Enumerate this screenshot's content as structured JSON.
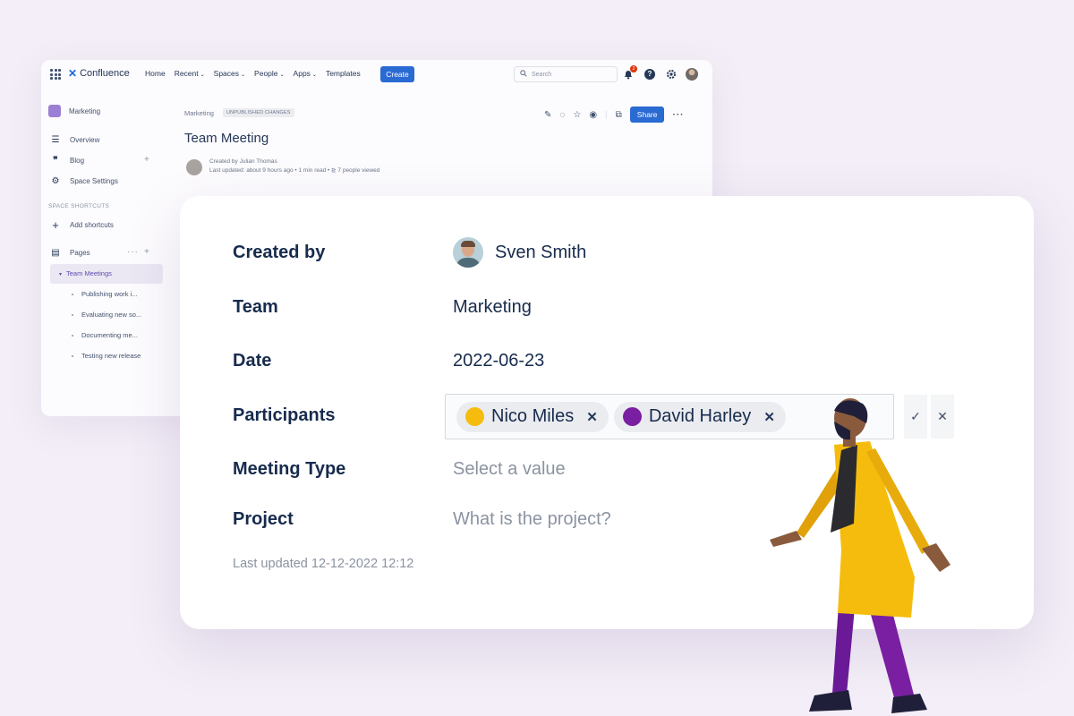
{
  "confluence": {
    "logo_text": "Confluence",
    "nav": [
      "Home",
      "Recent",
      "Spaces",
      "People",
      "Apps",
      "Templates"
    ],
    "nav_has_caret": [
      false,
      true,
      true,
      true,
      true,
      false
    ],
    "create_label": "Create",
    "search_placeholder": "Search",
    "notification_count": "2",
    "help_glyph": "?",
    "sidebar": {
      "space_name": "Marketing",
      "items": [
        {
          "label": "Overview",
          "icon": "overview-icon"
        },
        {
          "label": "Blog",
          "icon": "quote-icon"
        },
        {
          "label": "Space Settings",
          "icon": "gear-icon"
        }
      ],
      "shortcuts_heading": "SPACE SHORTCUTS",
      "add_shortcuts": "Add shortcuts",
      "pages_label": "Pages",
      "tree_root": "Team Meetings",
      "tree_children": [
        "Publishing work i...",
        "Evaluating new so...",
        "Documenting me...",
        "Testing new release"
      ]
    },
    "page": {
      "breadcrumb": "Marketing",
      "status_badge": "UNPUBLISHED CHANGES",
      "title": "Team Meeting",
      "created_by": "Created by Julian Thomas",
      "last_updated": "Last updated: about 9 hours ago",
      "read_time": "1 min read",
      "views": "7 people viewed",
      "share_label": "Share"
    }
  },
  "card": {
    "created_by_label": "Created by",
    "created_by_value": "Sven Smith",
    "team_label": "Team",
    "team_value": "Marketing",
    "date_label": "Date",
    "date_value": "2022-06-23",
    "participants_label": "Participants",
    "participants": [
      {
        "name": "Nico Miles",
        "color": "#f5bc0d"
      },
      {
        "name": "David Harley",
        "color": "#7a1fa2"
      }
    ],
    "meeting_type_label": "Meeting Type",
    "meeting_type_placeholder": "Select a value",
    "project_label": "Project",
    "project_placeholder": "What is the project?",
    "last_updated": "Last updated 12-12-2022 12:12"
  },
  "colors": {
    "background": "#f3eef7",
    "accent_blue": "#2a6ad3",
    "space_purple": "#9b7fd4",
    "coat_yellow": "#f5bc0d",
    "pants_purple": "#7a1fa2"
  }
}
